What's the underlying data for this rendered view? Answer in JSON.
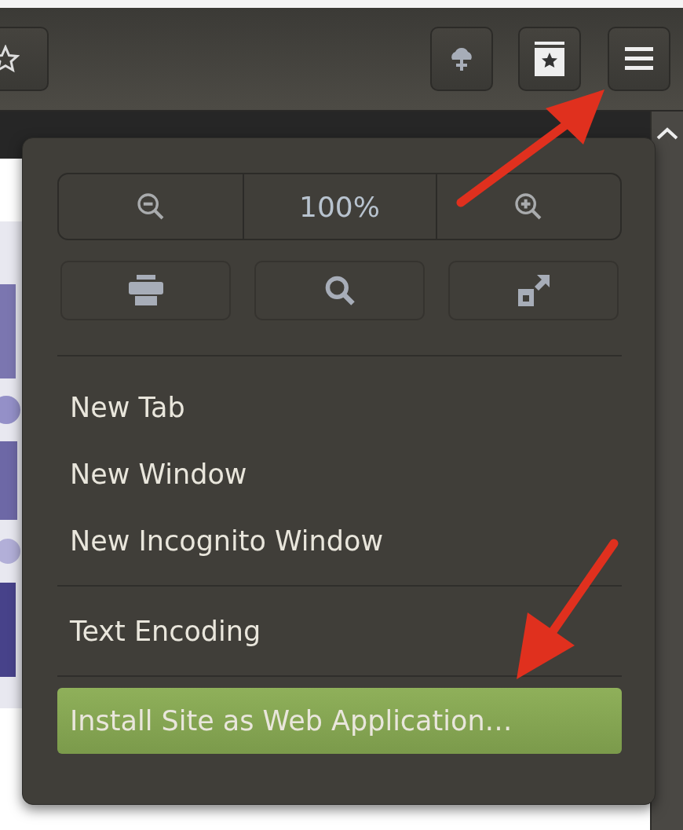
{
  "zoom": {
    "level_text": "100%"
  },
  "menu": {
    "sections": [
      [
        {
          "label": "New Tab",
          "selected": false
        },
        {
          "label": "New Window",
          "selected": false
        },
        {
          "label": "New Incognito Window",
          "selected": false
        }
      ],
      [
        {
          "label": "Text Encoding",
          "selected": false
        }
      ],
      [
        {
          "label": "Install Site as Web Application…",
          "selected": true
        }
      ]
    ]
  }
}
